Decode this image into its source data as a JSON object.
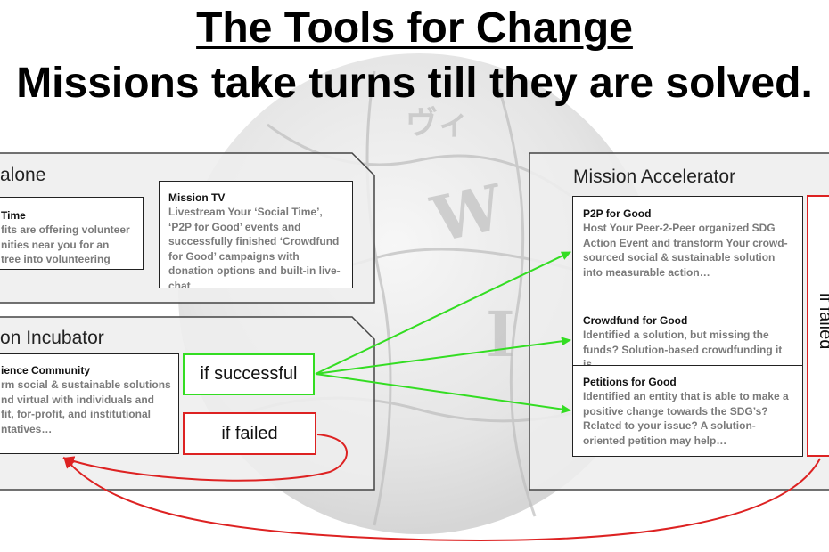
{
  "title": "The Tools for Change",
  "subtitle": "Missions take turns till they are solved.",
  "panels": {
    "standalone": {
      "label": "alone"
    },
    "incubator": {
      "label": "on Incubator"
    },
    "accelerator": {
      "label": "Mission Accelerator"
    }
  },
  "cards": {
    "social_time": {
      "title": "Time",
      "text": "fits are offering volunteer\nnities near you for an\ntree into volunteering"
    },
    "mission_tv": {
      "title": "Mission TV",
      "text": "Livestream Your ‘Social Time’, ‘P2P for Good’ events and successfully finished ‘Crowdfund for Good’ campaigns with donation options and built-in live-chat…"
    },
    "science_community": {
      "title": "ience Community",
      "text": "rm social & sustainable solutions\nnd virtual with individuals and\nfit, for-profit, and institutional\nntatives…"
    },
    "p2p_for_good": {
      "title": "P2P for Good",
      "text": "Host Your Peer-2-Peer organized SDG Action Event and transform Your crowd-sourced social & sustainable solution into measurable action…"
    },
    "crowdfund_for_good": {
      "title": "Crowdfund for Good",
      "text": "Identified a solution, but missing the funds? Solution-based crowdfunding it is…"
    },
    "petitions_for_good": {
      "title": "Petitions for Good",
      "text": "Identified an entity that is able to make a positive change towards the SDG’s? Related to your issue? A solution-oriented petition may help…"
    }
  },
  "conditions": {
    "if_successful": "if successful",
    "if_failed": "if failed",
    "if_failed_right": "if failed"
  },
  "colors": {
    "success_arrow": "#33dd22",
    "failed_arrow": "#dd2222",
    "panel_fill": "#eeeeee",
    "panel_border": "#444444"
  }
}
